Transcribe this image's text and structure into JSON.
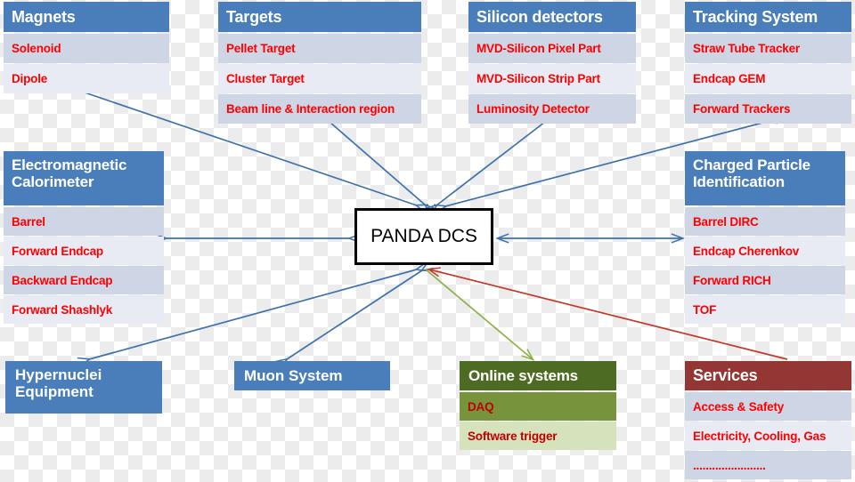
{
  "diagram": {
    "title": "PANDA DCS system overview",
    "center_node": {
      "label": "PANDA DCS"
    },
    "colors": {
      "header_blue": "#4a7ebb",
      "header_green": "#4e6b24",
      "header_dark_red": "#943634",
      "row_blue_gray": "#ced5e5",
      "row_light": "#e8ebf4",
      "row_green_mid": "#77933c",
      "row_green_light": "#d5e2bb",
      "item_text_red": "#ff0000",
      "arrow_blue": "#3e72ab",
      "arrow_green": "#8cb14b",
      "arrow_red": "#c0392b"
    },
    "groups": [
      {
        "id": "magnets",
        "header": "Magnets",
        "items": [
          "Solenoid",
          "Dipole"
        ]
      },
      {
        "id": "targets",
        "header": "Targets",
        "items": [
          "Pellet Target",
          "Cluster Target",
          "Beam line & Interaction  region"
        ]
      },
      {
        "id": "silicon-detectors",
        "header": "Silicon detectors",
        "items": [
          "MVD-Silicon Pixel Part",
          "MVD-Silicon Strip Part",
          "Luminosity Detector"
        ]
      },
      {
        "id": "tracking-system",
        "header": "Tracking System",
        "items": [
          "Straw Tube Tracker",
          "Endcap GEM",
          "Forward Trackers"
        ]
      },
      {
        "id": "electromagnetic-calorimeter",
        "header_line1": "Electromagnetic",
        "header_line2": "Calorimeter",
        "items": [
          "Barrel",
          "Forward Endcap",
          "Backward Endcap",
          "Forward Shashlyk"
        ]
      },
      {
        "id": "charged-particle-identification",
        "header_line1": "Charged Particle",
        "header_line2": "Identification",
        "items": [
          "Barrel DIRC",
          "Endcap Cherenkov",
          "Forward RICH",
          "TOF"
        ]
      },
      {
        "id": "hypernuclei-equipment",
        "header_line1": "Hypernuclei",
        "header_line2": "Equipment",
        "items": []
      },
      {
        "id": "muon-system",
        "header": "Muon System",
        "items": []
      },
      {
        "id": "online-systems",
        "header": "Online systems",
        "items": [
          "DAQ",
          "Software trigger"
        ]
      },
      {
        "id": "services",
        "header": "Services",
        "items": [
          "Access & Safety",
          "Electricity, Cooling,  Gas",
          "......................."
        ]
      }
    ]
  }
}
